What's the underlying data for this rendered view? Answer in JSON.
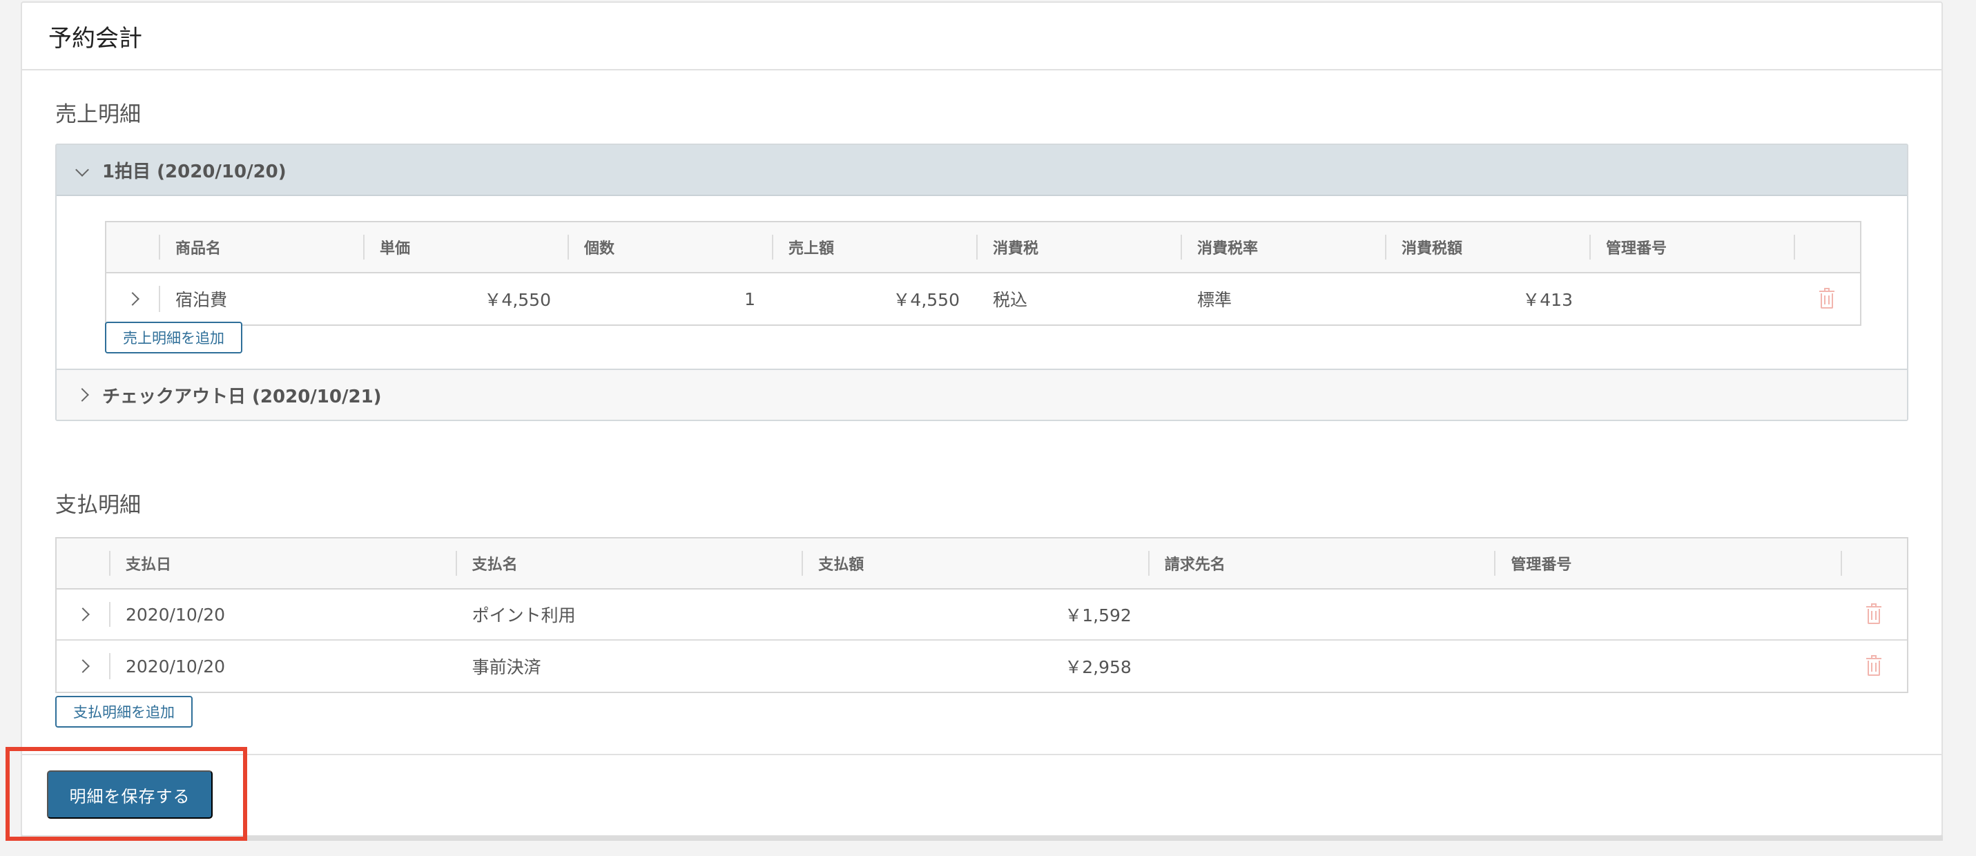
{
  "panel": {
    "title": "予約会計"
  },
  "sales": {
    "title": "売上明細",
    "day1": {
      "label": "1拍目 (2020/10/20)"
    },
    "checkout": {
      "label": "チェックアウト日 (2020/10/21)"
    },
    "columns": [
      "商品名",
      "単価",
      "個数",
      "売上額",
      "消費税",
      "消費税率",
      "消費税額",
      "管理番号"
    ],
    "rows": [
      {
        "name": "宿泊費",
        "unit_price": "￥4,550",
        "qty": "1",
        "amount": "￥4,550",
        "tax": "税込",
        "tax_rate": "標準",
        "tax_amount": "￥413",
        "mgmt_no": ""
      }
    ],
    "add_label": "売上明細を追加"
  },
  "payments": {
    "title": "支払明細",
    "columns": [
      "支払日",
      "支払名",
      "支払額",
      "請求先名",
      "管理番号"
    ],
    "rows": [
      {
        "date": "2020/10/20",
        "name": "ポイント利用",
        "amount": "￥1,592",
        "billing": "",
        "mgmt_no": ""
      },
      {
        "date": "2020/10/20",
        "name": "事前決済",
        "amount": "￥2,958",
        "billing": "",
        "mgmt_no": ""
      }
    ],
    "add_label": "支払明細を追加"
  },
  "save_label": "明細を保存する",
  "colors": {
    "accent": "#2b6f9c",
    "highlight": "#e8432e",
    "trash": "#f2b5ae",
    "accordion_open_bg": "#d9e1e6"
  },
  "icons": {
    "expand": "chevron-down-icon",
    "collapse": "chevron-right-icon",
    "delete": "trash-icon"
  }
}
